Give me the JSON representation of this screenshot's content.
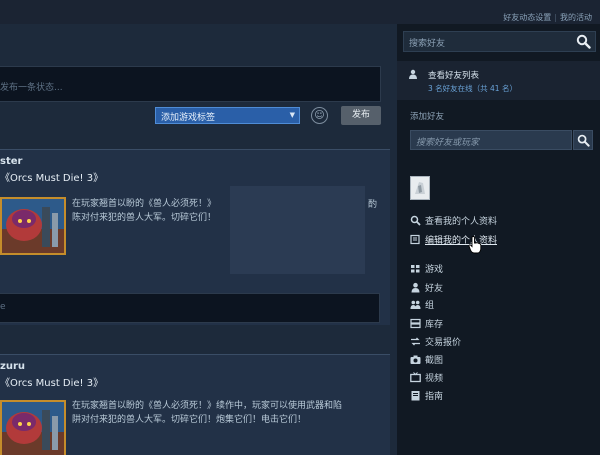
{
  "header": {
    "activity_settings": "好友动态设置",
    "separator": "|",
    "my_activity": "我的活动"
  },
  "composer": {
    "status_placeholder": "发布一条状态...",
    "tag_select": "添加游戏标签",
    "emoji_icon": "smiley-icon",
    "post_label": "发布"
  },
  "feed": [
    {
      "user": "ster",
      "game": "《Orcs Must Die! 3》",
      "description": "在玩家翘首以盼的《兽人必须死！》",
      "description_line2": "陈对付来犯的兽人大军。切碎它们！",
      "fragment": "酌",
      "comment_placeholder": "e"
    },
    {
      "user": "zuru",
      "game": "《Orcs Must Die! 3》",
      "description": "在玩家翘首以盼的《兽人必须死！》续作中，玩家可以使用武器和陷",
      "description_line2": "阱对付来犯的兽人大军。切碎它们！炮集它们！电击它们！"
    }
  ],
  "sidebar": {
    "search_placeholder": "搜索好友",
    "friends_list": {
      "title": "查看好友列表",
      "subtitle": "3 名好友在线（共 41 名）"
    },
    "add_friend_label": "添加好友",
    "friend_search_placeholder": "搜索好友或玩家",
    "menu": [
      {
        "label": "查看我的个人资料",
        "icon": "magnifier-icon"
      },
      {
        "label": "编辑我的个人资料",
        "icon": "edit-icon"
      },
      {
        "label": "游戏",
        "icon": "games-icon"
      },
      {
        "label": "好友",
        "icon": "person-icon"
      },
      {
        "label": "组",
        "icon": "group-icon"
      },
      {
        "label": "库存",
        "icon": "inventory-icon"
      },
      {
        "label": "交易报价",
        "icon": "trade-icon"
      },
      {
        "label": "截图",
        "icon": "camera-icon"
      },
      {
        "label": "视频",
        "icon": "tv-icon"
      },
      {
        "label": "指南",
        "icon": "guide-icon"
      }
    ]
  },
  "colors": {
    "page_bg": "#16202d",
    "sidebar_bg": "#111923",
    "card_bg": "#223147",
    "accent_blue": "#2a5fa8",
    "link_blue": "#6aa3d8",
    "thumb_border": "#c58d2b"
  }
}
